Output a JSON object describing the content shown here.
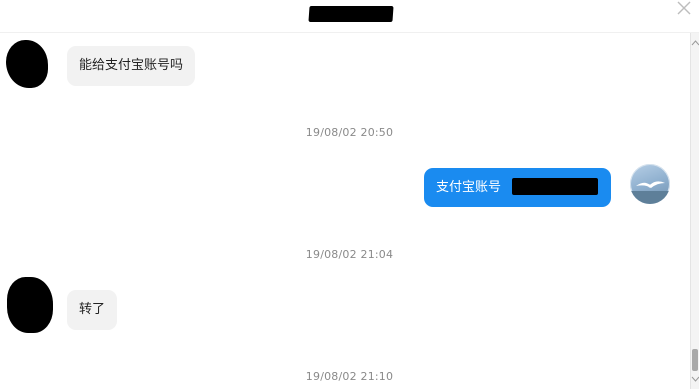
{
  "header": {
    "title_redacted": true
  },
  "messages": [
    {
      "side": "in",
      "text": "能给支付宝账号吗"
    },
    {
      "side": "ts",
      "text": "19/08/02 20:50"
    },
    {
      "side": "out",
      "text": "支付宝账号"
    },
    {
      "side": "ts",
      "text": "19/08/02 21:04"
    },
    {
      "side": "in",
      "text": "转了"
    },
    {
      "side": "ts",
      "text": "19/08/02 21:10"
    }
  ],
  "colors": {
    "outgoing_bubble": "#1a8bf0",
    "incoming_bubble": "#f2f2f2",
    "timestamp": "#8a8a8a"
  },
  "icons": {
    "close": "close-icon",
    "self_avatar": "seagull-avatar-icon"
  }
}
